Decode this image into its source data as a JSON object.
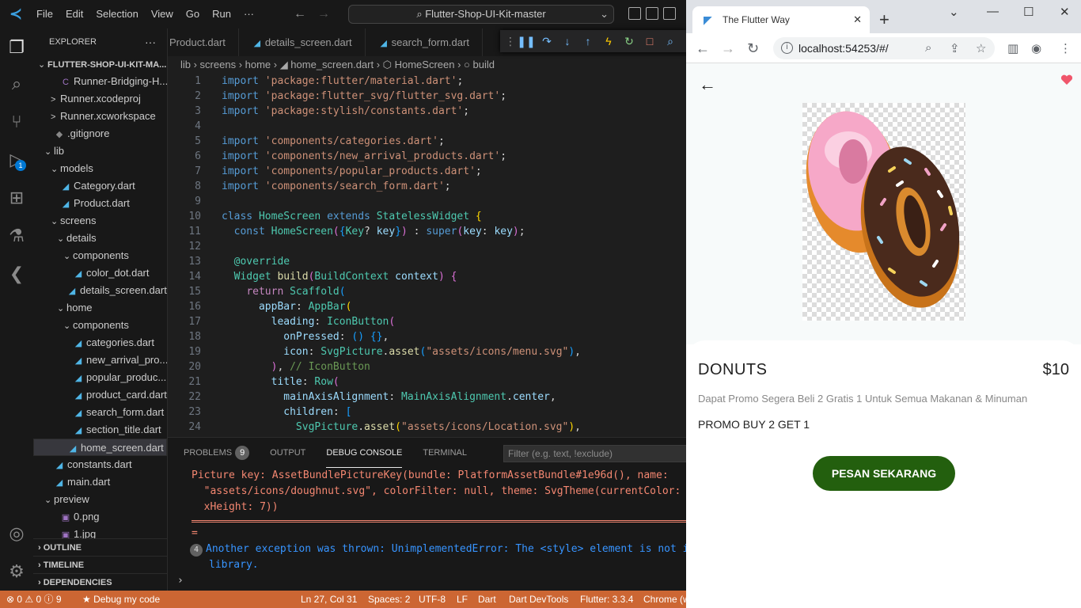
{
  "vscode": {
    "menu": [
      "File",
      "Edit",
      "Selection",
      "View",
      "Go",
      "Run",
      "···"
    ],
    "command_center": "⌕ Flutter-Shop-UI-Kit-master",
    "activity_badge": "1",
    "explorer_title": "EXPLORER",
    "tree": [
      {
        "label": "FLUTTER-SHOP-UI-KIT-MA...",
        "twisty": "⌄",
        "icon": "",
        "kind": "root",
        "indent": 0
      },
      {
        "label": "Runner-Bridging-H...",
        "twisty": "",
        "icon": "C",
        "kind": "swift",
        "indent": 2
      },
      {
        "label": "Runner.xcodeproj",
        "twisty": ">",
        "icon": "",
        "kind": "folder",
        "indent": 2
      },
      {
        "label": "Runner.xcworkspace",
        "twisty": ">",
        "icon": "",
        "kind": "folder",
        "indent": 2
      },
      {
        "label": ".gitignore",
        "twisty": "",
        "icon": "◆",
        "kind": "git",
        "indent": 1
      },
      {
        "label": "lib",
        "twisty": "⌄",
        "icon": "",
        "kind": "folder",
        "indent": 1
      },
      {
        "label": "models",
        "twisty": "⌄",
        "icon": "",
        "kind": "folder",
        "indent": 2
      },
      {
        "label": "Category.dart",
        "twisty": "",
        "icon": "◢",
        "kind": "dart",
        "indent": 2
      },
      {
        "label": "Product.dart",
        "twisty": "",
        "icon": "◢",
        "kind": "dart",
        "indent": 2
      },
      {
        "label": "screens",
        "twisty": "⌄",
        "icon": "",
        "kind": "folder",
        "indent": 2
      },
      {
        "label": "details",
        "twisty": "⌄",
        "icon": "",
        "kind": "folder",
        "indent": 3
      },
      {
        "label": "components",
        "twisty": "⌄",
        "icon": "",
        "kind": "folder",
        "indent": 4
      },
      {
        "label": "color_dot.dart",
        "twisty": "",
        "icon": "◢",
        "kind": "dart",
        "indent": 4
      },
      {
        "label": "details_screen.dart",
        "twisty": "",
        "icon": "◢",
        "kind": "dart",
        "indent": 3
      },
      {
        "label": "home",
        "twisty": "⌄",
        "icon": "",
        "kind": "folder",
        "indent": 3
      },
      {
        "label": "components",
        "twisty": "⌄",
        "icon": "",
        "kind": "folder",
        "indent": 4
      },
      {
        "label": "categories.dart",
        "twisty": "",
        "icon": "◢",
        "kind": "dart",
        "indent": 4
      },
      {
        "label": "new_arrival_pro...",
        "twisty": "",
        "icon": "◢",
        "kind": "dart",
        "indent": 4
      },
      {
        "label": "popular_produc...",
        "twisty": "",
        "icon": "◢",
        "kind": "dart",
        "indent": 4
      },
      {
        "label": "product_card.dart",
        "twisty": "",
        "icon": "◢",
        "kind": "dart",
        "indent": 4
      },
      {
        "label": "search_form.dart",
        "twisty": "",
        "icon": "◢",
        "kind": "dart",
        "indent": 4
      },
      {
        "label": "section_title.dart",
        "twisty": "",
        "icon": "◢",
        "kind": "dart",
        "indent": 4
      },
      {
        "label": "home_screen.dart",
        "twisty": "",
        "icon": "◢",
        "kind": "dart",
        "indent": 3,
        "selected": true
      },
      {
        "label": "constants.dart",
        "twisty": "",
        "icon": "◢",
        "kind": "dart",
        "indent": 1
      },
      {
        "label": "main.dart",
        "twisty": "",
        "icon": "◢",
        "kind": "dart",
        "indent": 1
      },
      {
        "label": "preview",
        "twisty": "⌄",
        "icon": "",
        "kind": "folder",
        "indent": 1
      },
      {
        "label": "0.png",
        "twisty": "",
        "icon": "▣",
        "kind": "img",
        "indent": 2
      },
      {
        "label": "1.jpg",
        "twisty": "",
        "icon": "▣",
        "kind": "img",
        "indent": 2
      }
    ],
    "sections": {
      "outline": "OUTLINE",
      "timeline": "TIMELINE",
      "dependencies": "DEPENDENCIES"
    },
    "tabs": [
      "Product.dart",
      "details_screen.dart",
      "search_form.dart"
    ],
    "breadcrumb": "lib  ›  screens  ›  home  ›  ◢ home_screen.dart  ›  ⬡ HomeScreen  ›  ○ build",
    "code": [
      [
        [
          "kw",
          "import "
        ],
        [
          "str",
          "'package:flutter/material.dart'"
        ],
        [
          "tx",
          ";"
        ]
      ],
      [
        [
          "kw",
          "import "
        ],
        [
          "str",
          "'package:flutter_svg/flutter_svg.dart'"
        ],
        [
          "tx",
          ";"
        ]
      ],
      [
        [
          "kw",
          "import "
        ],
        [
          "str",
          "'package:stylish/constants.dart'"
        ],
        [
          "tx",
          ";"
        ]
      ],
      [],
      [
        [
          "kw",
          "import "
        ],
        [
          "str",
          "'components/categories.dart'"
        ],
        [
          "tx",
          ";"
        ]
      ],
      [
        [
          "kw",
          "import "
        ],
        [
          "str",
          "'components/new_arrival_products.dart'"
        ],
        [
          "tx",
          ";"
        ]
      ],
      [
        [
          "kw",
          "import "
        ],
        [
          "str",
          "'components/popular_products.dart'"
        ],
        [
          "tx",
          ";"
        ]
      ],
      [
        [
          "kw",
          "import "
        ],
        [
          "str",
          "'components/search_form.dart'"
        ],
        [
          "tx",
          ";"
        ]
      ],
      [],
      [
        [
          "kw",
          "class "
        ],
        [
          "cls",
          "HomeScreen "
        ],
        [
          "kw",
          "extends "
        ],
        [
          "cls",
          "StatelessWidget "
        ],
        [
          "pn",
          "{"
        ]
      ],
      [
        [
          "tx",
          "  "
        ],
        [
          "kw",
          "const "
        ],
        [
          "cls",
          "HomeScreen"
        ],
        [
          "pl",
          "("
        ],
        [
          "pu",
          "{"
        ],
        [
          "cls",
          "Key"
        ],
        [
          "tx",
          "? "
        ],
        [
          "prm",
          "key"
        ],
        [
          "pu",
          "}"
        ],
        [
          "pl",
          ")"
        ],
        [
          "tx",
          " : "
        ],
        [
          "kw",
          "super"
        ],
        [
          "pl",
          "("
        ],
        [
          "prm",
          "key"
        ],
        [
          "tx",
          ": "
        ],
        [
          "prm",
          "key"
        ],
        [
          "pl",
          ")"
        ],
        [
          "tx",
          ";"
        ]
      ],
      [],
      [
        [
          "tx",
          "  "
        ],
        [
          "cls",
          "@override"
        ]
      ],
      [
        [
          "tx",
          "  "
        ],
        [
          "cls",
          "Widget "
        ],
        [
          "fn",
          "build"
        ],
        [
          "pl",
          "("
        ],
        [
          "cls",
          "BuildContext "
        ],
        [
          "prm",
          "context"
        ],
        [
          "pl",
          ")"
        ],
        [
          "tx",
          " "
        ],
        [
          "pl",
          "{"
        ]
      ],
      [
        [
          "tx",
          "    "
        ],
        [
          "ctrl",
          "return "
        ],
        [
          "cls",
          "Scaffold"
        ],
        [
          "pu",
          "("
        ]
      ],
      [
        [
          "tx",
          "      "
        ],
        [
          "prm",
          "appBar"
        ],
        [
          "tx",
          ": "
        ],
        [
          "cls",
          "AppBar"
        ],
        [
          "pn",
          "("
        ]
      ],
      [
        [
          "tx",
          "        "
        ],
        [
          "prm",
          "leading"
        ],
        [
          "tx",
          ": "
        ],
        [
          "cls",
          "IconButton"
        ],
        [
          "pl",
          "("
        ]
      ],
      [
        [
          "tx",
          "          "
        ],
        [
          "prm",
          "onPressed"
        ],
        [
          "tx",
          ": "
        ],
        [
          "pu",
          "() {}"
        ],
        [
          "tx",
          ","
        ]
      ],
      [
        [
          "tx",
          "          "
        ],
        [
          "prm",
          "icon"
        ],
        [
          "tx",
          ": "
        ],
        [
          "cls",
          "SvgPicture"
        ],
        [
          "tx",
          "."
        ],
        [
          "fn",
          "asset"
        ],
        [
          "pu",
          "("
        ],
        [
          "str",
          "\"assets/icons/menu.svg\""
        ],
        [
          "pu",
          ")"
        ],
        [
          "tx",
          ","
        ]
      ],
      [
        [
          "tx",
          "        "
        ],
        [
          "pl",
          ")"
        ],
        [
          "tx",
          ", "
        ],
        [
          "cm",
          "// IconButton"
        ]
      ],
      [
        [
          "tx",
          "        "
        ],
        [
          "prm",
          "title"
        ],
        [
          "tx",
          ": "
        ],
        [
          "cls",
          "Row"
        ],
        [
          "pl",
          "("
        ]
      ],
      [
        [
          "tx",
          "          "
        ],
        [
          "prm",
          "mainAxisAlignment"
        ],
        [
          "tx",
          ": "
        ],
        [
          "cls",
          "MainAxisAlignment"
        ],
        [
          "tx",
          "."
        ],
        [
          "prm",
          "center"
        ],
        [
          "tx",
          ","
        ]
      ],
      [
        [
          "tx",
          "          "
        ],
        [
          "prm",
          "children"
        ],
        [
          "tx",
          ": "
        ],
        [
          "pu",
          "["
        ]
      ],
      [
        [
          "tx",
          "            "
        ],
        [
          "cls",
          "SvgPicture"
        ],
        [
          "tx",
          "."
        ],
        [
          "fn",
          "asset"
        ],
        [
          "pn",
          "("
        ],
        [
          "str",
          "\"assets/icons/Location.svg\""
        ],
        [
          "pn",
          ")"
        ],
        [
          "tx",
          ","
        ]
      ]
    ],
    "panel": {
      "tabs": [
        "PROBLEMS",
        "OUTPUT",
        "DEBUG CONSOLE",
        "TERMINAL"
      ],
      "problems_count": "9",
      "filter_placeholder": "Filter (e.g. text, !exclude)",
      "out_line1": "Picture key: AssetBundlePictureKey(bundle: PlatformAssetBundle#1e96d(), name:",
      "out_line2": "  \"assets/icons/doughnut.svg\", colorFilter: null, theme: SvgTheme(currentColor: n",
      "out_line3": "  xHeight: 7))",
      "out_eq": "=",
      "repeat_count": "4",
      "out_line4": "Another exception was thrown: UnimplementedError: The <style> element is not in",
      "out_line5": "library.",
      "prompt": "›"
    },
    "status": {
      "errors": "⊗ 0 ⚠ 0 ⓘ 9",
      "debug": "★ Debug my code",
      "position": "Ln 27, Col 31",
      "spaces": "Spaces: 2",
      "encoding": "UTF-8",
      "eol": "LF",
      "language": "Dart",
      "devtools": "Dart DevTools",
      "flutter": "Flutter: 3.3.4",
      "device": "Chrome (w"
    }
  },
  "browser": {
    "tab_title": "The Flutter Way",
    "url": "localhost:54253/#/",
    "product": {
      "name": "DONUTS",
      "price": "$10",
      "description": "Dapat Promo Segera Beli 2 Gratis 1 Untuk Semua Makanan & Minuman",
      "promo": "PROMO BUY 2 GET 1",
      "button": "PESAN SEKARANG"
    },
    "colors": {
      "button": "#235f0e",
      "heart": "#f0566b",
      "status_bar": "#cc6633"
    }
  }
}
